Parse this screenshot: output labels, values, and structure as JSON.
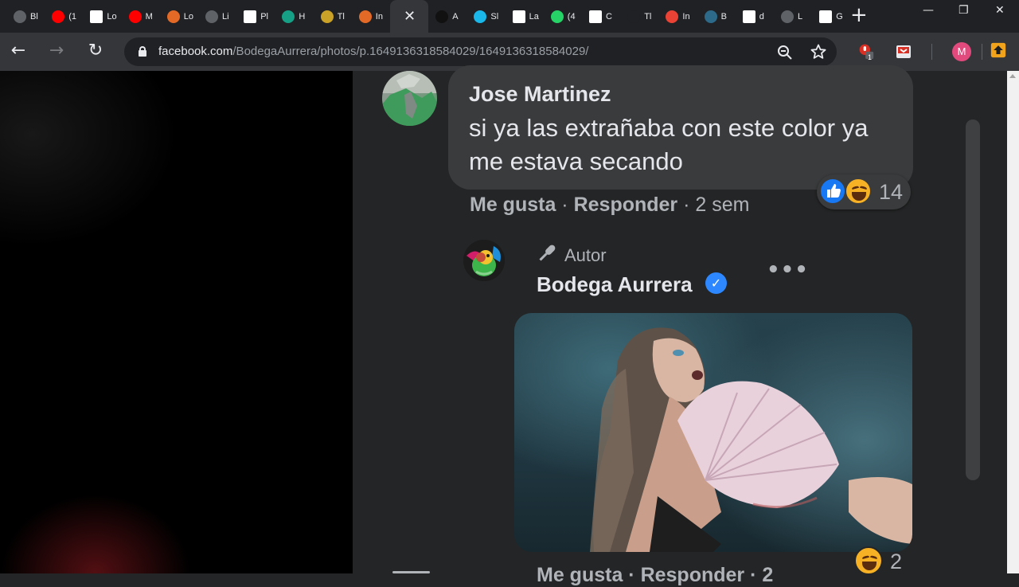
{
  "browser": {
    "tabs": [
      {
        "label": "Bl",
        "icon": "globe-icon",
        "color": "#5f6368"
      },
      {
        "label": "(1",
        "icon": "youtube-icon",
        "color": "#ff0000"
      },
      {
        "label": "Lo",
        "icon": "page-icon",
        "color": "#ffffff"
      },
      {
        "label": "M",
        "icon": "youtube-icon",
        "color": "#ff0000"
      },
      {
        "label": "Lo",
        "icon": "n-icon",
        "color": "#e36a26"
      },
      {
        "label": "Li",
        "icon": "globe-icon",
        "color": "#5f6368"
      },
      {
        "label": "Pl",
        "icon": "page-icon",
        "color": "#ffffff"
      },
      {
        "label": "H",
        "icon": "p-icon",
        "color": "#16a085"
      },
      {
        "label": "Tl",
        "icon": "nd-icon",
        "color": "#c9a227"
      },
      {
        "label": "In",
        "icon": "ud-icon",
        "color": "#e36a26"
      },
      {
        "label": "",
        "icon": "close-icon",
        "color": "#35363a",
        "active": true
      },
      {
        "label": "A",
        "icon": "badge-icon",
        "color": "#111111"
      },
      {
        "label": "Sl",
        "icon": "vimeo-icon",
        "color": "#1ab7ea"
      },
      {
        "label": "La",
        "icon": "page-icon",
        "color": "#ffffff"
      },
      {
        "label": "(4",
        "icon": "whatsapp-icon",
        "color": "#25d366"
      },
      {
        "label": "C",
        "icon": "page-icon",
        "color": "#ffffff"
      },
      {
        "label": "Tl",
        "icon": "bird-icon",
        "color": "#202124"
      },
      {
        "label": "In",
        "icon": "gmail-icon",
        "color": "#ea4335"
      },
      {
        "label": "B",
        "icon": "ship-icon",
        "color": "#2d6a8a"
      },
      {
        "label": "d",
        "icon": "google-icon",
        "color": "#ffffff"
      },
      {
        "label": "L",
        "icon": "globe-icon",
        "color": "#5f6368"
      },
      {
        "label": "G",
        "icon": "google-icon",
        "color": "#ffffff"
      }
    ],
    "new_tab": "+",
    "window": {
      "minimize": "—",
      "restore": "❐",
      "close": "✕"
    },
    "nav": {
      "back": "←",
      "forward": "→",
      "reload": "↻"
    },
    "url_host": "facebook.com",
    "url_path": "/BodegaAurrera/photos/p.1649136318584029/1649136318584029/",
    "extension_badge": "1",
    "profile_initial": "M"
  },
  "comment": {
    "author": "Jose Martinez",
    "text": "si ya las extrañaba con este color ya me estava secando",
    "reaction_count": "14",
    "like": "Me gusta",
    "dot1": " · ",
    "reply": "Responder",
    "dot2": " · ",
    "time": "2 sem"
  },
  "reply": {
    "badge": "Autor",
    "author": "Bodega Aurrera",
    "more": "•••",
    "reaction_count": "2",
    "cut_actions": "Me gusta · Responder · 2"
  },
  "colors": {
    "facebook_blue": "#1877f2",
    "verified_blue": "#2d88ff",
    "haha_yellow": "#f7b125",
    "panel_bg": "#242526",
    "bubble_bg": "#3a3b3c"
  }
}
